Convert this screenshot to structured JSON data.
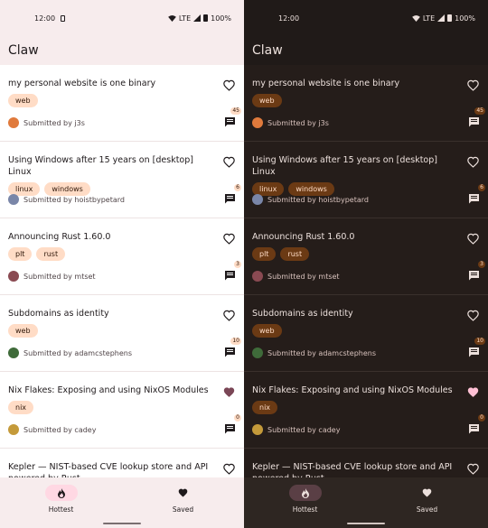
{
  "status": {
    "time": "12:00",
    "network": "LTE",
    "battery": "100%"
  },
  "app": {
    "title": "Claw"
  },
  "stories": [
    {
      "title": "my personal website is one binary",
      "tags": [
        "web"
      ],
      "submitter": "Submitted by j3s",
      "comments": "45",
      "saved": false,
      "avatar_color": "#e07a3c"
    },
    {
      "title": "Using Windows after 15 years on [desktop] Linux",
      "tags": [
        "linux",
        "windows"
      ],
      "submitter": "Submitted by hoistbypetard",
      "comments": "6",
      "saved": false,
      "avatar_color": "#7a86a8"
    },
    {
      "title": "Announcing Rust 1.60.0",
      "tags": [
        "plt",
        "rust"
      ],
      "submitter": "Submitted by mtset",
      "comments": "3",
      "saved": false,
      "avatar_color": "#8a4a52"
    },
    {
      "title": "Subdomains as identity",
      "tags": [
        "web"
      ],
      "submitter": "Submitted by adamcstephens",
      "comments": "10",
      "saved": false,
      "avatar_color": "#3f6b3a"
    },
    {
      "title": "Nix Flakes: Exposing and using NixOS Modules",
      "tags": [
        "nix"
      ],
      "submitter": "Submitted by cadey",
      "comments": "0",
      "saved": true,
      "avatar_color": "#c49a3a"
    },
    {
      "title": "Kepler — NIST-based CVE lookup store and API powered by Rust",
      "tags": [],
      "submitter": "",
      "comments": "",
      "saved": false,
      "avatar_color": "#999999"
    }
  ],
  "nav": {
    "hottest": "Hottest",
    "saved": "Saved"
  },
  "colors": {
    "light_accent": "#ffdcc6",
    "dark_accent": "#6b3a14",
    "light_bg": "#f7eced",
    "dark_bg": "#201a18"
  }
}
